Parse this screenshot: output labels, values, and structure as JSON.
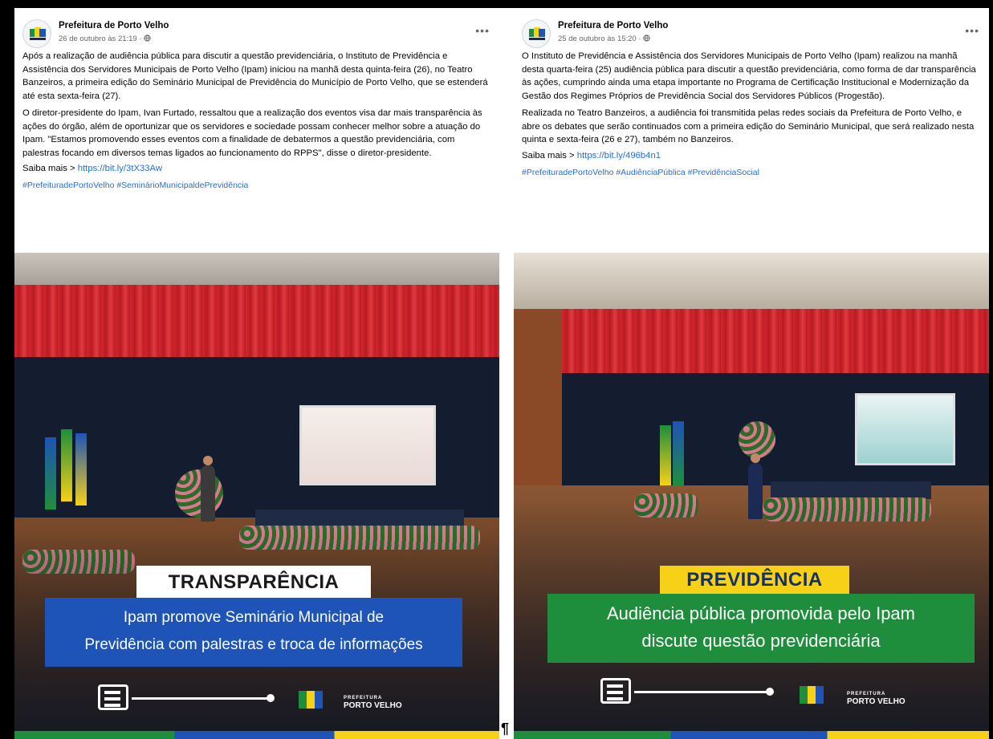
{
  "posts": [
    {
      "page_name": "Prefeitura de Porto Velho",
      "date": "26 de outubro às 21:19 · ",
      "paragraphs": [
        "Após a realização de audiência pública para discutir a questão previdenciária, o Instituto de Previdência e Assistência dos Servidores Municipais de Porto Velho (Ipam) iniciou na manhã desta quinta-feira (26), no Teatro Banzeiros, a primeira edição do Seminário Municipal de Previdência do Município de Porto Velho, que se estenderá até esta sexta-feira (27).",
        "O diretor-presidente do Ipam, Ivan Furtado, ressaltou que a realização dos eventos visa dar mais transparência às ações do órgão, além de oportunizar que os servidores e sociedade possam conhecer melhor sobre a atuação do Ipam. \"Estamos promovendo esses eventos com a finalidade de debatermos a questão previdenciária, com palestras focando em diversos temas ligados ao funcionamento do RPPS\", disse o diretor-presidente."
      ],
      "saiba_label": "Saiba mais > ",
      "link": "https://bit.ly/3tX33Aw",
      "hashtags": "#PrefeituradePortoVelho #SeminárioMunicipaldePrevidência",
      "image_tag": "TRANSPARÊNCIA",
      "banner_line1": "Ipam promove Seminário Municipal de",
      "banner_line2": "Previdência com palestras e troca de informações",
      "logo_small": "PREFEITURA",
      "logo_big": "PORTO VELHO"
    },
    {
      "page_name": "Prefeitura de Porto Velho",
      "date": "25 de outubro às 15:20 · ",
      "paragraphs": [
        "O Instituto de Previdência e Assistência dos Servidores Municipais de Porto Velho (Ipam) realizou na manhã desta quarta-feira (25) audiência pública para discutir a questão previdenciária, como forma de dar transparência às ações, cumprindo ainda uma etapa importante no Programa de Certificação Institucional e Modernização da Gestão dos Regimes Próprios de Previdência Social dos Servidores Públicos (Progestão).",
        "Realizada no Teatro Banzeiros, a audiência foi transmitida pelas redes sociais da Prefeitura de Porto Velho, e abre os debates que serão continuados com a primeira edição do Seminário Municipal, que será realizado nesta quinta e sexta-feira (26 e 27), também no Banzeiros."
      ],
      "saiba_label": "Saiba mais > ",
      "link": "https://bit.ly/496b4n1",
      "hashtags": "#PrefeituradePortoVelho #AudiênciaPública #PrevidênciaSocial",
      "image_tag": "PREVIDÊNCIA",
      "banner_line1": "Audiência pública promovida pelo Ipam",
      "banner_line2": "discute questão previdenciária",
      "logo_small": "PREFEITURA",
      "logo_big": "PORTO VELHO"
    }
  ],
  "more_icon": "ellipsis-icon",
  "globe_icon": "globe-icon",
  "pilcrow": "¶",
  "colors": {
    "link": "#216fdb",
    "blue_banner": "#1e53b7",
    "green_banner": "#1f8e3c",
    "yellow_tag": "#f7d117"
  }
}
